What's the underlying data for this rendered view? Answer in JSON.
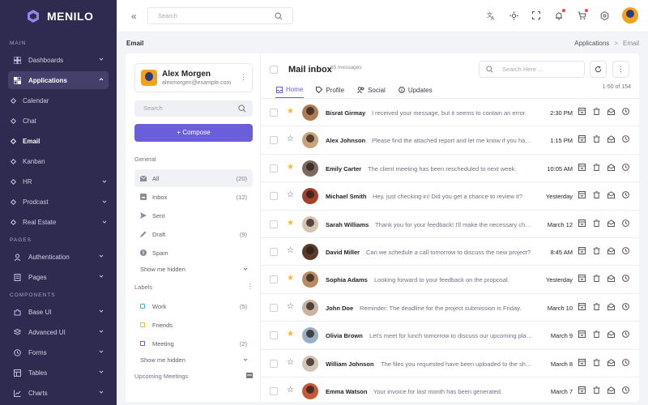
{
  "brand": {
    "name": "MENILO",
    "accent": "#6b5fd9",
    "sidebar_bg": "#2f2a4f"
  },
  "sidebar": {
    "sections": {
      "main": "MAIN",
      "pages": "PAGES",
      "components": "COMPONENTS"
    },
    "main_items": [
      {
        "label": "Dashboards",
        "icon": "grid-icon"
      },
      {
        "label": "Applications",
        "icon": "apps-icon"
      }
    ],
    "app_subitems": [
      {
        "label": "Calendar"
      },
      {
        "label": "Chat"
      },
      {
        "label": "Email"
      },
      {
        "label": "Kanban"
      },
      {
        "label": "HR"
      },
      {
        "label": "Prodcast"
      },
      {
        "label": "Real Estate"
      }
    ],
    "page_items": [
      {
        "label": "Authentication",
        "icon": "user-icon"
      },
      {
        "label": "Pages",
        "icon": "file-icon"
      }
    ],
    "component_items": [
      {
        "label": "Base UI",
        "icon": "puzzle-icon"
      },
      {
        "label": "Advanced UI",
        "icon": "layers-icon"
      },
      {
        "label": "Forms",
        "icon": "clock-icon"
      },
      {
        "label": "Tables",
        "icon": "table-icon"
      },
      {
        "label": "Charts",
        "icon": "chart-icon"
      }
    ]
  },
  "topbar": {
    "search_placeholder": "Search"
  },
  "breadcrumb": {
    "page_title": "Email",
    "parent": "Applications",
    "separator": ">",
    "current": "Email"
  },
  "profile": {
    "name": "Alex Morgen",
    "email": "alexmorgen@example.com"
  },
  "left": {
    "search_placeholder": "Search",
    "compose_label": "+ Compose",
    "general_title": "General",
    "folders": [
      {
        "label": "All",
        "count": "(20)"
      },
      {
        "label": "Inbox",
        "count": "(12)"
      },
      {
        "label": "Sent",
        "count": ""
      },
      {
        "label": "Draft",
        "count": "(9)"
      },
      {
        "label": "Spam",
        "count": ""
      }
    ],
    "show_hidden": "Show me hidden",
    "labels_title": "Labels",
    "labels": [
      {
        "label": "Work",
        "count": "(5)",
        "color": "#2bb6e8"
      },
      {
        "label": "Friends",
        "count": "",
        "color": "#f5b82e"
      },
      {
        "label": "Meeting",
        "count": "(2)",
        "color": "#6b5fd9"
      }
    ],
    "show_hidden_2": "Show me hidden",
    "upcoming": "Upcoming Meetings"
  },
  "inbox": {
    "title": "Mail inbox",
    "count": "85 messages",
    "search_placeholder": "Search Here ...",
    "tabs": [
      "Home",
      "Profile",
      "Social",
      "Updates"
    ],
    "pager": "1-50 of 154",
    "emails": [
      {
        "sender": "Bisrat Girmay",
        "snippet": "I received your message, but it seems to contain an error.",
        "time": "2:30 PM",
        "starred": true,
        "avatar": "#b07a52"
      },
      {
        "sender": "Alex Johnson",
        "snippet": "Please find the attached report and let me know if you have questions.",
        "time": "1:15 PM",
        "starred": false,
        "avatar": "#c9a27c"
      },
      {
        "sender": "Emily Carter",
        "snippet": "The client meeting has been rescheduled to next week.",
        "time": "10:05 AM",
        "starred": true,
        "avatar": "#7a6a60"
      },
      {
        "sender": "Michael Smith",
        "snippet": "Hey, just checking in! Did you get a chance to review it?",
        "time": "Yesterday",
        "starred": false,
        "avatar": "#a3402e"
      },
      {
        "sender": "Sarah Williams",
        "snippet": "Thank you for your feedback! I'll make the necessary changes.",
        "time": "March 12",
        "starred": true,
        "avatar": "#d6c3b0"
      },
      {
        "sender": "David Miller",
        "snippet": "Can we schedule a call tomorrow to discuss the new project?",
        "time": "8:45 AM",
        "starred": false,
        "avatar": "#5a3b2c"
      },
      {
        "sender": "Sophia Adams",
        "snippet": "Looking forward to your feedback on the proposal.",
        "time": "Yesterday",
        "starred": true,
        "avatar": "#b98a62"
      },
      {
        "sender": "John Doe",
        "snippet": "Reminder: The deadline for the project submission is Friday.",
        "time": "March 10",
        "starred": false,
        "avatar": "#c7b3a0"
      },
      {
        "sender": "Olivia Brown",
        "snippet": "Let's meet for lunch tomorrow to discuss our upcoming plans.",
        "time": "March 9",
        "starred": true,
        "avatar": "#9ab0c4"
      },
      {
        "sender": "William Johnson",
        "snippet": "The files you requested have been uploaded to the shared folder.",
        "time": "March 8",
        "starred": false,
        "avatar": "#d2c5b8"
      },
      {
        "sender": "Emma Watson",
        "snippet": "Your invoice for last month has been generated.",
        "time": "March 7",
        "starred": false,
        "avatar": "#c45a3a"
      }
    ]
  }
}
